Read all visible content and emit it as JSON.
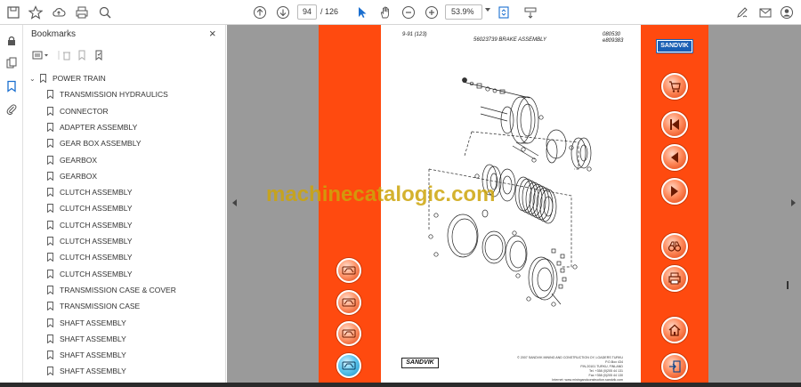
{
  "toolbar": {
    "page_current": "94",
    "page_total": "/ 126",
    "zoom": "53.9%"
  },
  "bookmarks": {
    "title": "Bookmarks",
    "close_glyph": "×",
    "parent": "POWER TRAIN",
    "items": [
      "TRANSMISSION HYDRAULICS",
      "CONNECTOR",
      "ADAPTER ASSEMBLY",
      "GEAR BOX ASSEMBLY",
      "GEARBOX",
      "GEARBOX",
      "CLUTCH ASSEMBLY",
      "CLUTCH ASSEMBLY",
      "CLUTCH ASSEMBLY",
      "CLUTCH ASSEMBLY",
      "CLUTCH ASSEMBLY",
      "CLUTCH ASSEMBLY",
      "TRANSMISSION CASE & COVER",
      "TRANSMISSION CASE",
      "SHAFT ASSEMBLY",
      "SHAFT ASSEMBLY",
      "SHAFT ASSEMBLY",
      "SHAFT ASSEMBLY"
    ]
  },
  "page": {
    "top_left": "9-91 (123)",
    "title": "56023739 BRAKE ASSEMBLY",
    "top_right_1": "080530",
    "top_right_2": "e809383",
    "brand_box": "SANDVIK",
    "footer_brand": "SANDVIK",
    "footer_lines": [
      "© 2007 SANDVIK MINING AND CONSTRUCTION OY, LOADERS TURKU",
      "P.O.Box 434",
      "FIN-20101 TURKU, FINLAND",
      "Tel. +358 (0)205 44 131",
      "Fax +358 (0)205 44 130",
      "Internet: www.miningandconstruction.sandvik.com"
    ]
  },
  "watermark": "machinecatalogic.com",
  "colors": {
    "accent_orange": "#ff4a0f",
    "sandvik_blue": "#1a5fb4",
    "viewer_gray": "#9a9a9a",
    "watermark": "#cda50a"
  },
  "icons": {
    "nav_buttons_right": [
      "cart-icon",
      "first-page-icon",
      "previous-page-icon",
      "next-page-icon",
      "binoculars-icon",
      "print-icon",
      "home-icon",
      "exit-icon"
    ],
    "nav_buttons_left": [
      "machine-icon",
      "machine-icon",
      "machine-icon",
      "machine-icon-active"
    ]
  }
}
